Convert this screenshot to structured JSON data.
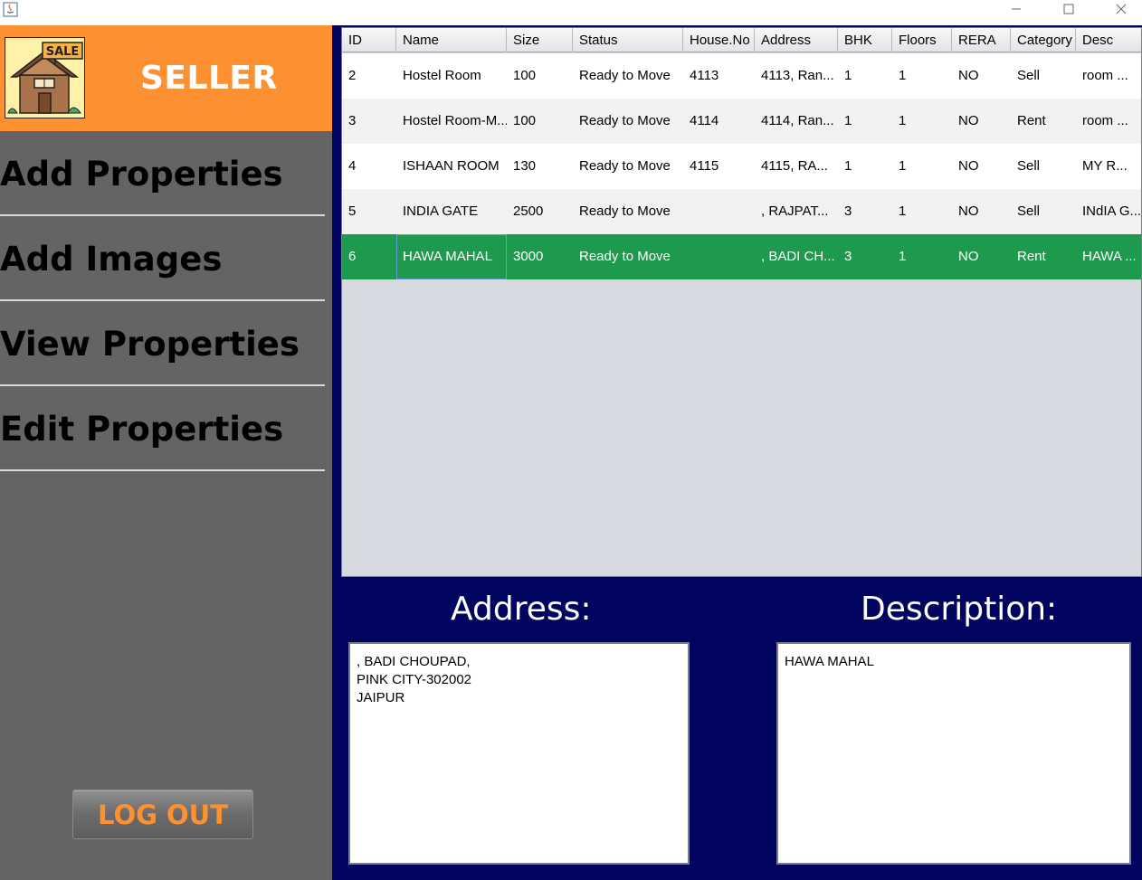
{
  "window": {
    "minimize": "—",
    "maximize": "☐",
    "close": "✕"
  },
  "sidebar": {
    "title": "SELLER",
    "logo_sign": "SALE",
    "items": [
      {
        "label": "Add Properties"
      },
      {
        "label": "Add Images"
      },
      {
        "label": "View Properties"
      },
      {
        "label": "Edit Properties"
      }
    ],
    "logout_label": "LOG OUT"
  },
  "table": {
    "columns": [
      "ID",
      "Name",
      "Size",
      "Status",
      "House.No",
      "Address",
      "BHK",
      "Floors",
      "RERA",
      "Category",
      "Desc"
    ],
    "rows": [
      [
        "2",
        "Hostel Room",
        "100",
        "Ready to Move",
        "4113",
        "4113, Ran...",
        "1",
        "1",
        "NO",
        "Sell",
        "room ..."
      ],
      [
        "3",
        "Hostel Room-M...",
        "100",
        "Ready to Move",
        "4114",
        "4114, Ran...",
        "1",
        "1",
        "NO",
        "Rent",
        "room ..."
      ],
      [
        "4",
        "ISHAAN ROOM",
        "130",
        "Ready to Move",
        "4115",
        "4115, RA...",
        "1",
        "1",
        "NO",
        "Sell",
        "MY R..."
      ],
      [
        "5",
        "INDIA GATE",
        "2500",
        "Ready to Move",
        "",
        ", RAJPAT...",
        "3",
        "1",
        "NO",
        "Sell",
        "INdIA G..."
      ],
      [
        "6",
        "HAWA MAHAL",
        "3000",
        "Ready to Move",
        "",
        ", BADI CH...",
        "3",
        "1",
        "NO",
        "Rent",
        "HAWA ..."
      ]
    ],
    "selected_row": 4
  },
  "details": {
    "address_label": "Address:",
    "address_text": ", BADI CHOUPAD,\nPINK CITY-302002\nJAIPUR",
    "description_label": "Description:",
    "description_text": "HAWA MAHAL"
  },
  "colors": {
    "sidebar_bg": "#646464",
    "brand_orange": "#fd9030",
    "main_bg": "#02055f",
    "selected_row": "#1d9a4e"
  }
}
